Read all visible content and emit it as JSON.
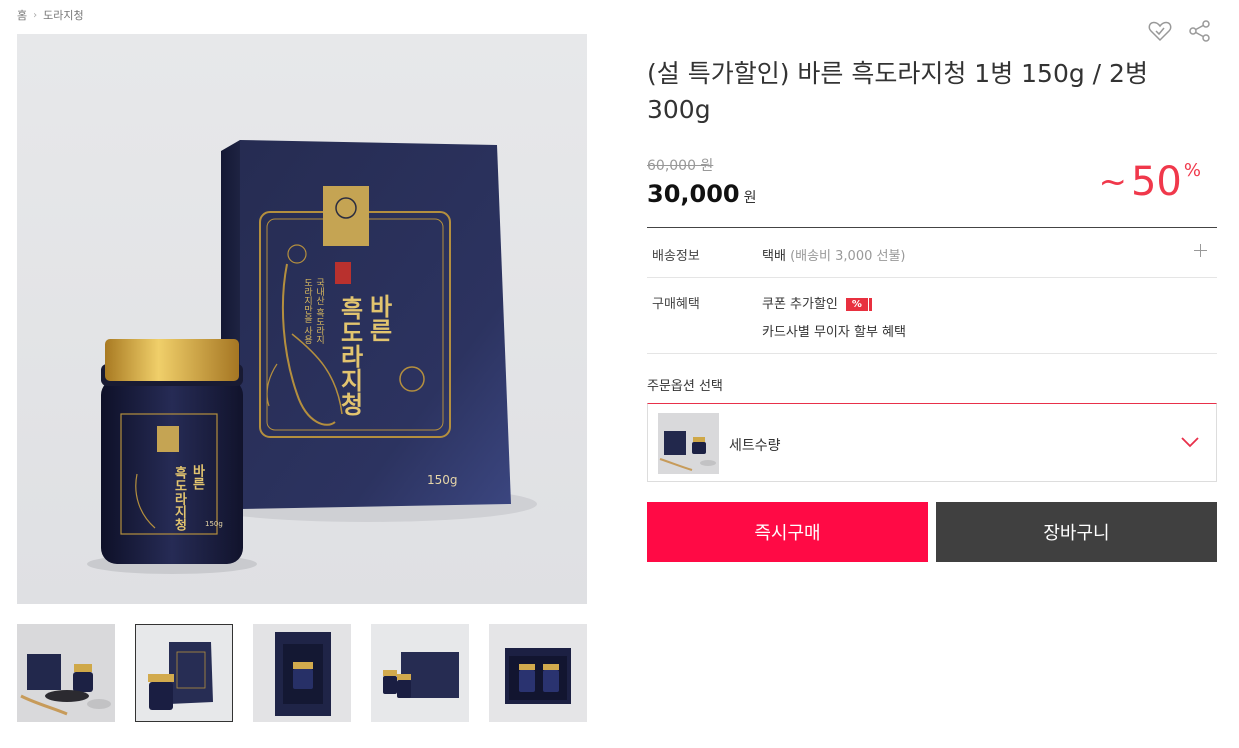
{
  "breadcrumb": {
    "home": "홈",
    "sep": "›",
    "category": "도라지청"
  },
  "product": {
    "title": "(설 특가할인) 바른 흑도라지청 1병 150g / 2병 300g",
    "original_price": "60,000 원",
    "sale_price": "30,000",
    "currency": "원",
    "discount_prefix": "~",
    "discount_value": "50",
    "discount_symbol": "%"
  },
  "packaging": {
    "box_name_line1": "바른",
    "box_name_line2": "흑도라지청",
    "box_sub1": "국내산 흑도라지",
    "box_sub2": "도라지만을 사용",
    "box_weight": "150g",
    "jar_weight": "150g"
  },
  "info": {
    "shipping_label": "배송정보",
    "shipping_value": "택배",
    "shipping_sub": "(배송비 3,000 선불)",
    "benefit_label": "구매혜택",
    "benefit_coupon": "쿠폰 추가할인",
    "benefit_badge": "%",
    "benefit_card": "카드사별 무이자 할부 혜택"
  },
  "option": {
    "title": "주문옵션 선택",
    "select_label": "세트수량"
  },
  "buttons": {
    "buy": "즉시구매",
    "cart": "장바구니"
  },
  "icons": [
    "heart-icon",
    "share-icon",
    "plus-icon",
    "chevron-down-icon"
  ],
  "colors": {
    "accent": "#ff0a45",
    "discount": "#f0384b",
    "cart": "#404040",
    "package": "#1f2446",
    "gold": "#c9a24a"
  }
}
